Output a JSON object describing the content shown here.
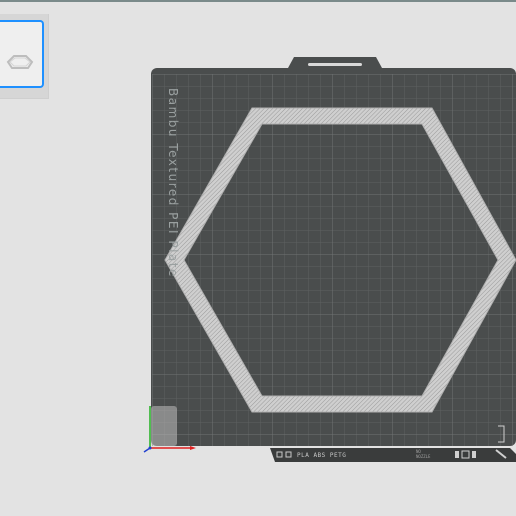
{
  "thumbnail": {
    "selected": true,
    "icon": "object-preview-icon"
  },
  "build_plate": {
    "name": "Bambu Textured PEI Plate",
    "filament_strip": "PLA ABS PETG",
    "strip_small_a": "NO",
    "strip_small_b": "NOZZLE",
    "grid": "on",
    "object": "hexagon-frame",
    "colors": {
      "plate": "#4a4d4d",
      "grid_minor": "#5b5e5e",
      "grid_major": "#6c6f6f",
      "object": "#c9c9c9",
      "accent": "#1e90ff",
      "axis_x": "#e02020",
      "axis_y": "#20b020",
      "axis_z": "#2040d0"
    }
  }
}
